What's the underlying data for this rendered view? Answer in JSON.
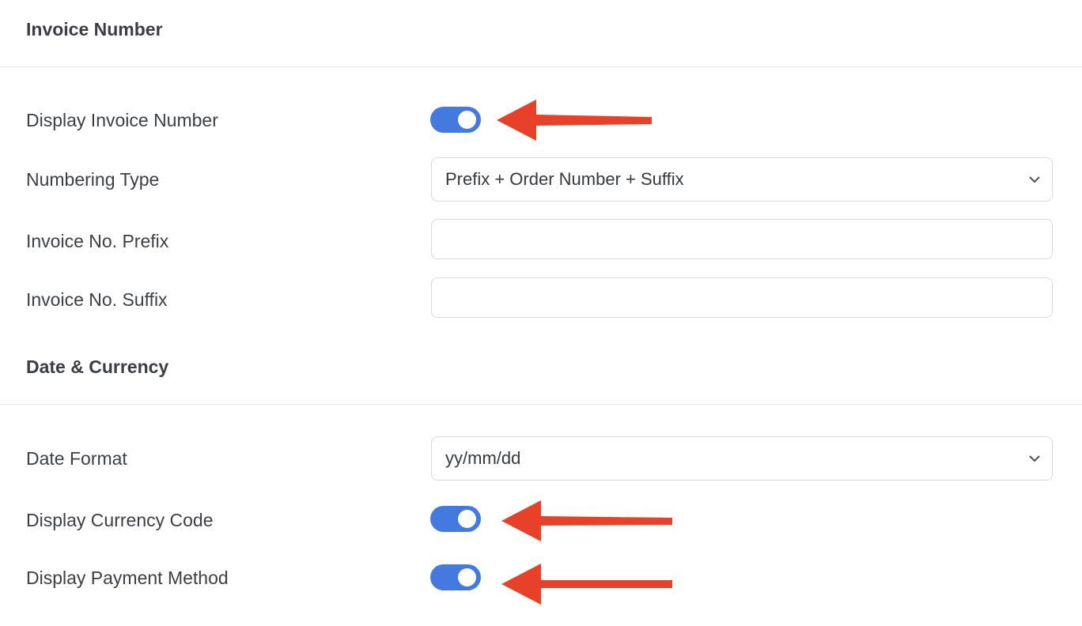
{
  "sections": {
    "invoice_number": {
      "title": "Invoice Number",
      "display_invoice_number": {
        "label": "Display Invoice Number",
        "enabled": true
      },
      "numbering_type": {
        "label": "Numbering Type",
        "selected": "Prefix + Order Number + Suffix"
      },
      "prefix": {
        "label": "Invoice No. Prefix",
        "value": "",
        "placeholder": ""
      },
      "suffix": {
        "label": "Invoice No. Suffix",
        "value": "",
        "placeholder": ""
      }
    },
    "date_currency": {
      "title": "Date & Currency",
      "date_format": {
        "label": "Date Format",
        "selected": "yy/mm/dd"
      },
      "display_currency_code": {
        "label": "Display Currency Code",
        "enabled": true
      },
      "display_payment_method": {
        "label": "Display Payment Method",
        "enabled": true
      }
    }
  },
  "colors": {
    "toggle_on": "#4479e0",
    "annotation_arrow": "#e8412a",
    "divider": "#e6e8eb",
    "input_border": "#d5dbe3"
  },
  "annotations": [
    {
      "type": "arrow",
      "points_to": "display-invoice-number-toggle"
    },
    {
      "type": "arrow",
      "points_to": "display-currency-code-toggle"
    },
    {
      "type": "arrow",
      "points_to": "display-payment-method-toggle"
    }
  ]
}
